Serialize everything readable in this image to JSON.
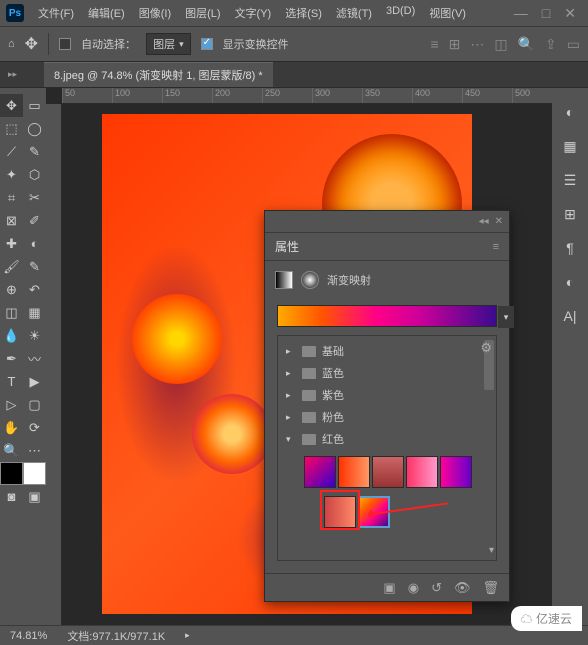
{
  "app": {
    "logo_text": "Ps"
  },
  "menu": {
    "file": "文件(F)",
    "edit": "编辑(E)",
    "image": "图像(I)",
    "layer": "图层(L)",
    "type": "文字(Y)",
    "select": "选择(S)",
    "filter": "滤镜(T)",
    "threed": "3D(D)",
    "view": "视图(V)"
  },
  "options": {
    "autoselect_label": "自动选择：",
    "layer_dropdown": "图层",
    "show_transform": "显示变换控件"
  },
  "tab": {
    "title": "8.jpeg @ 74.8% (渐变映射 1, 图层蒙版/8) *"
  },
  "ruler": {
    "marks": [
      "50",
      "100",
      "150",
      "200",
      "250",
      "300",
      "350",
      "400",
      "450",
      "500"
    ]
  },
  "panel": {
    "title": "属性",
    "type_label": "渐变映射",
    "folders": {
      "basic": "基础",
      "blue": "蓝色",
      "purple": "紫色",
      "pink": "粉色",
      "red": "红色"
    }
  },
  "status": {
    "zoom": "74.81%",
    "doc": "文档:977.1K/977.1K"
  },
  "watermark": "亿速云"
}
